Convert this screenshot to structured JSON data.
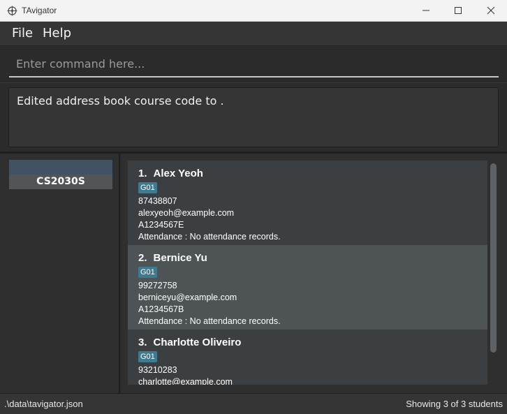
{
  "window": {
    "title": "TAvigator",
    "controls": {
      "minimize_icon": "minimize-icon",
      "maximize_icon": "maximize-icon",
      "close_icon": "close-icon"
    }
  },
  "menu": {
    "file": "File",
    "help": "Help"
  },
  "command": {
    "placeholder": "Enter command here...",
    "value": ""
  },
  "result": {
    "message": "Edited address book course code to ."
  },
  "courses": [
    {
      "code": "CS2030S"
    }
  ],
  "students": [
    {
      "index": "1.",
      "name": "Alex Yeoh",
      "tag": "G01",
      "phone": "87438807",
      "email": "alexyeoh@example.com",
      "student_id": "A1234567E",
      "attendance": "Attendance : No attendance records."
    },
    {
      "index": "2.",
      "name": "Bernice Yu",
      "tag": "G01",
      "phone": "99272758",
      "email": "berniceyu@example.com",
      "student_id": "A1234567B",
      "attendance": "Attendance : No attendance records."
    },
    {
      "index": "3.",
      "name": "Charlotte Oliveiro",
      "tag": "G01",
      "phone": "93210283",
      "email": "charlotte@example.com",
      "student_id": "",
      "attendance": ""
    }
  ],
  "status": {
    "file_path": ".\\data\\tavigator.json",
    "count_text": "Showing 3 of 3 students"
  },
  "colors": {
    "tag": "#3e7b91",
    "course_accent": "#425265",
    "selected_row": "#4e5456",
    "background": "#2b2b2b"
  }
}
